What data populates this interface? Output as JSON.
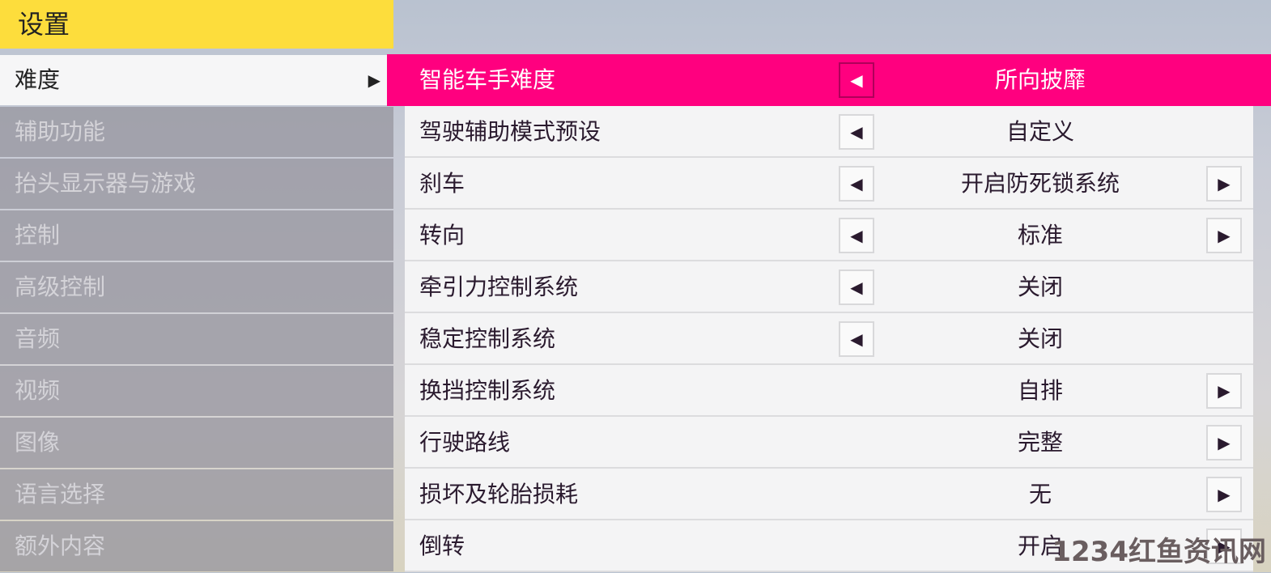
{
  "title": "设置",
  "sidebar": {
    "items": [
      {
        "label": "难度",
        "active": true
      },
      {
        "label": "辅助功能"
      },
      {
        "label": "抬头显示器与游戏"
      },
      {
        "label": "控制"
      },
      {
        "label": "高级控制"
      },
      {
        "label": "音频"
      },
      {
        "label": "视频"
      },
      {
        "label": "图像"
      },
      {
        "label": "语言选择"
      },
      {
        "label": "额外内容"
      }
    ],
    "arrow": "▶"
  },
  "rows": [
    {
      "label": "智能车手难度",
      "value": "所向披靡",
      "left": true,
      "right": false,
      "highlight": true
    },
    {
      "label": "驾驶辅助模式预设",
      "value": "自定义",
      "left": true,
      "right": false
    },
    {
      "label": "刹车",
      "value": "开启防死锁系统",
      "left": true,
      "right": true
    },
    {
      "label": "转向",
      "value": "标准",
      "left": true,
      "right": true
    },
    {
      "label": "牵引力控制系统",
      "value": "关闭",
      "left": true,
      "right": false
    },
    {
      "label": "稳定控制系统",
      "value": "关闭",
      "left": true,
      "right": false
    },
    {
      "label": "换挡控制系统",
      "value": "自排",
      "left": false,
      "right": true
    },
    {
      "label": "行驶路线",
      "value": "完整",
      "left": false,
      "right": true
    },
    {
      "label": "损坏及轮胎损耗",
      "value": "无",
      "left": false,
      "right": true
    },
    {
      "label": "倒转",
      "value": "开启",
      "left": false,
      "right": true
    }
  ],
  "icons": {
    "left": "◀",
    "right": "▶"
  },
  "colors": {
    "title": "#fddd3c",
    "highlight": "#ff007f"
  },
  "watermark": "1234红鱼资讯网"
}
